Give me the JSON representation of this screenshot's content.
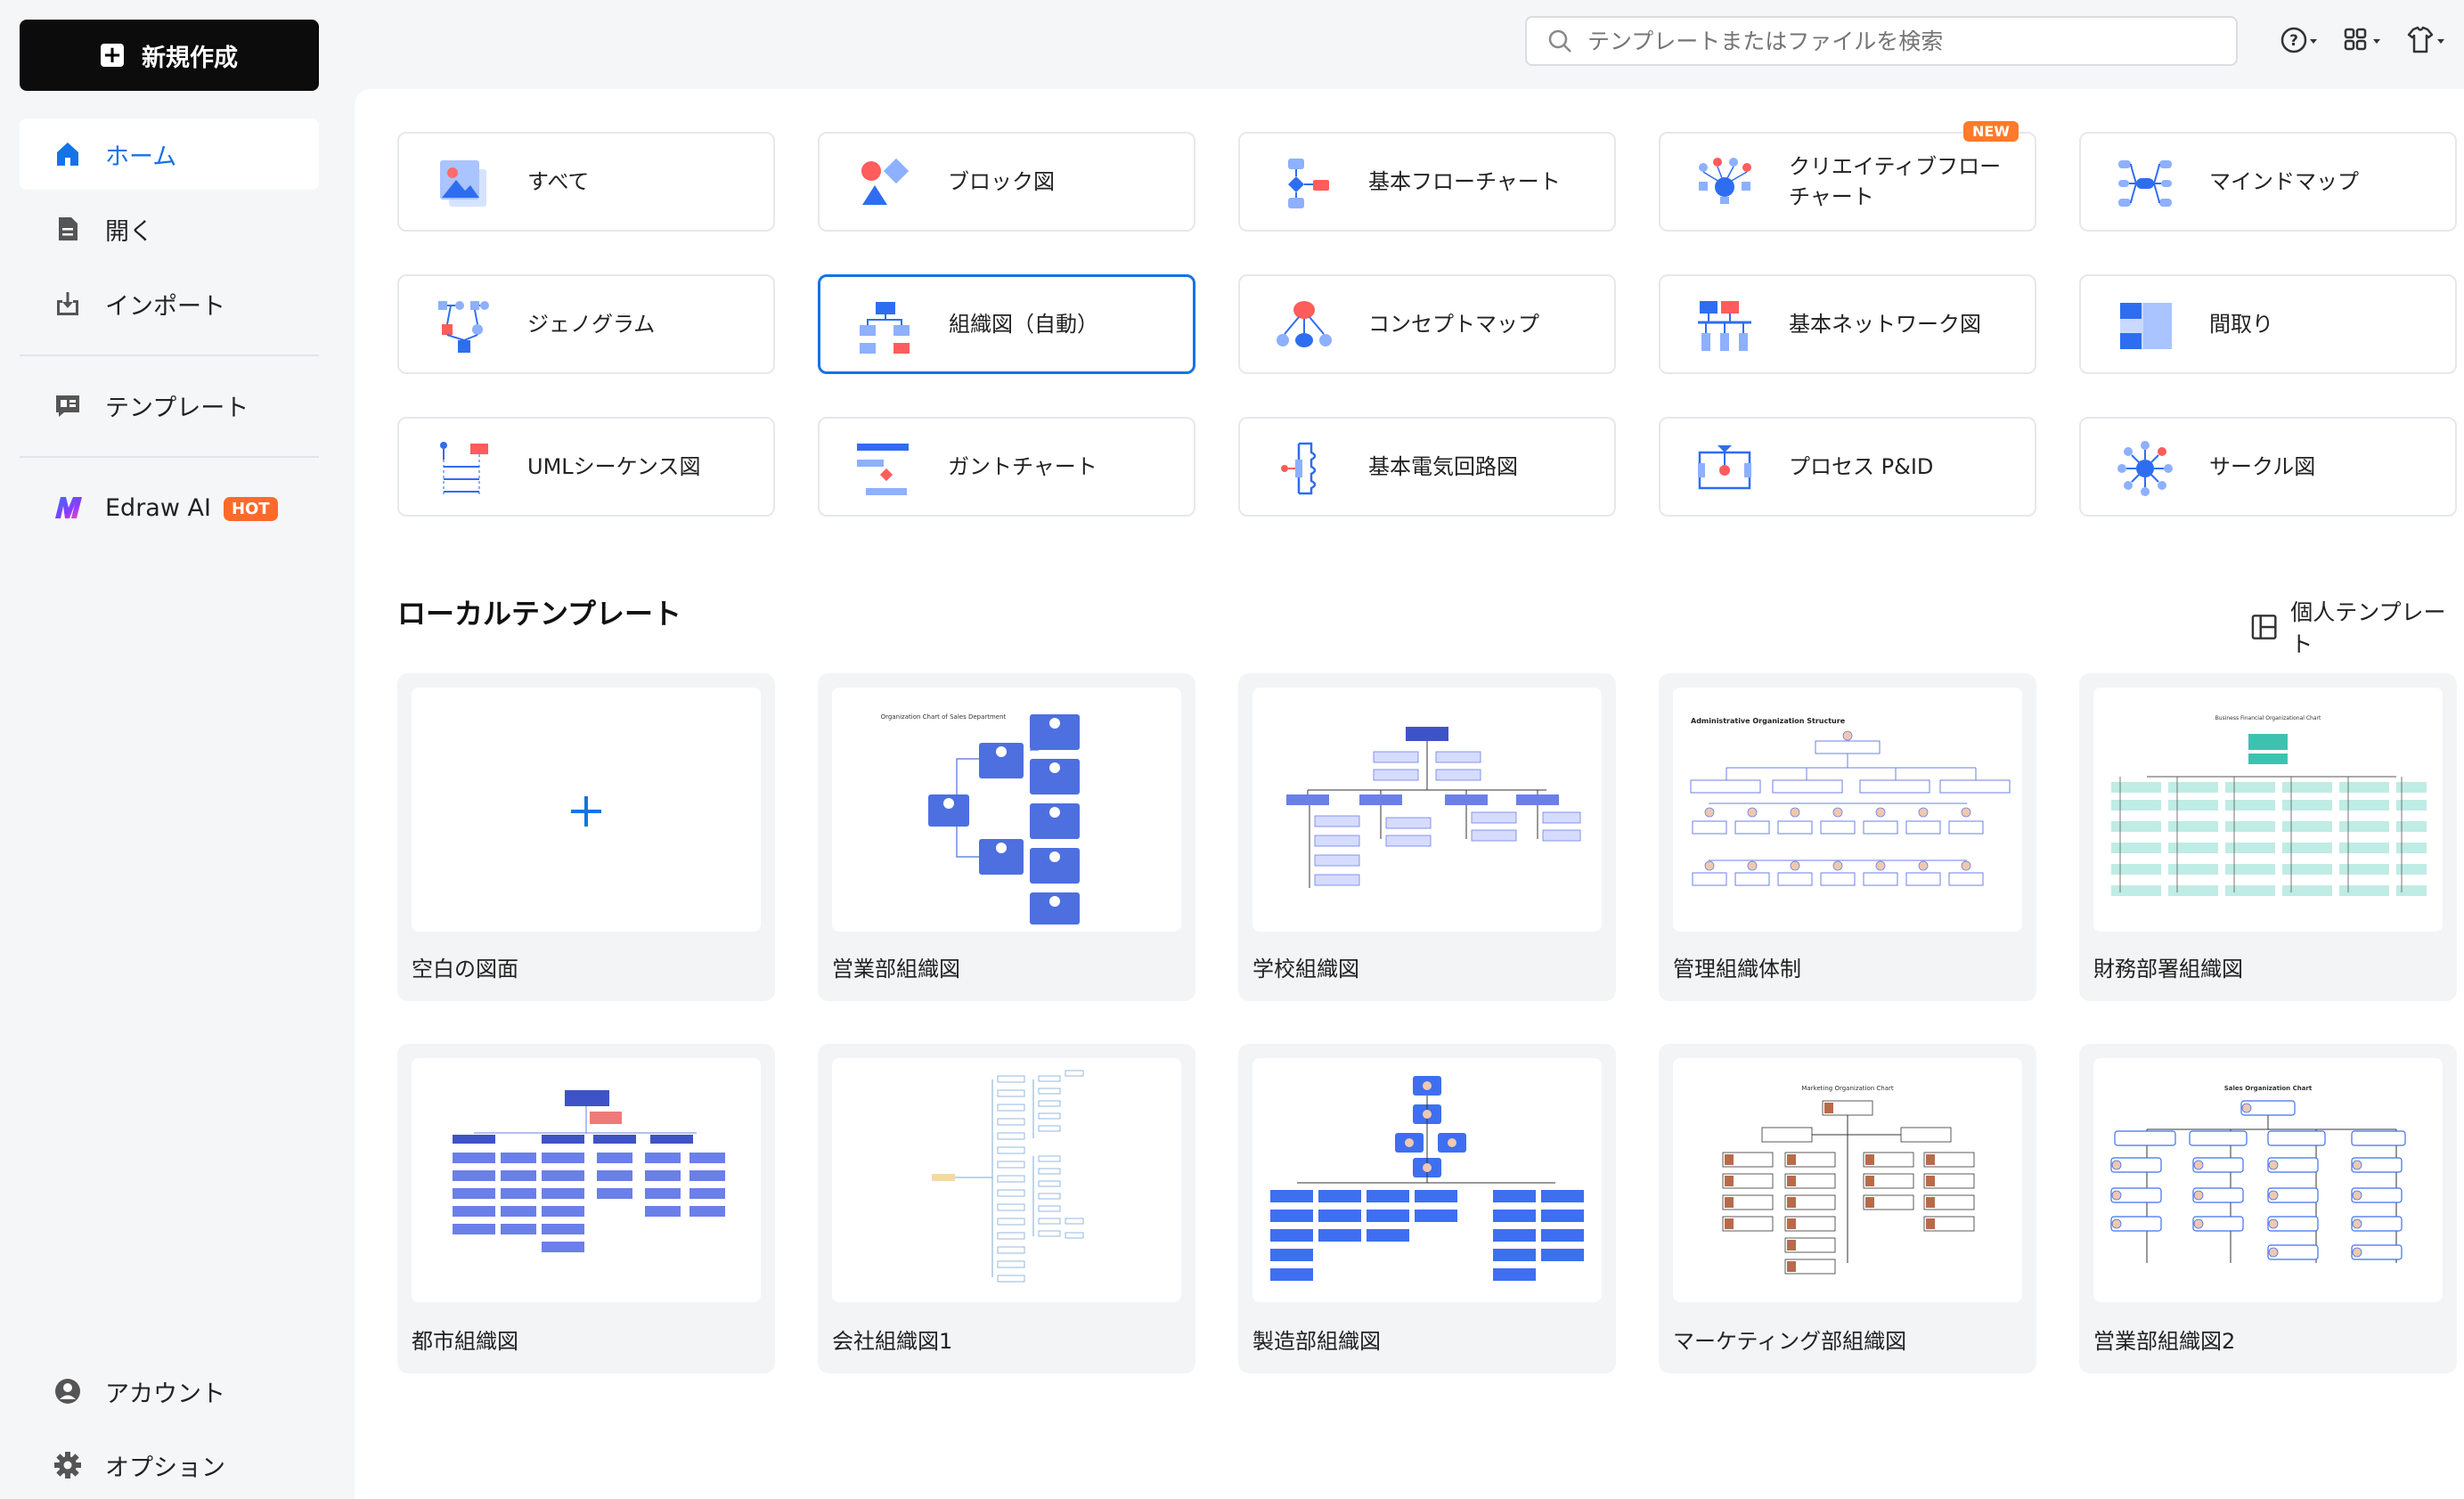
{
  "sidebar": {
    "new_button": "新規作成",
    "items": [
      {
        "label": "ホーム",
        "icon": "home-icon"
      },
      {
        "label": "開く",
        "icon": "file-icon"
      },
      {
        "label": "インポート",
        "icon": "import-icon"
      },
      {
        "label": "テンプレート",
        "icon": "template-icon"
      },
      {
        "label": "Edraw AI",
        "icon": "edraw-ai-logo-icon",
        "badge": "HOT"
      }
    ],
    "bottom": [
      {
        "label": "アカウント",
        "icon": "account-icon"
      },
      {
        "label": "オプション",
        "icon": "gear-icon"
      }
    ]
  },
  "search": {
    "placeholder": "テンプレートまたはファイルを検索"
  },
  "categories": [
    {
      "label": "すべて"
    },
    {
      "label": "ブロック図"
    },
    {
      "label": "基本フローチャート"
    },
    {
      "label": "クリエイティブフローチャート",
      "badge": "NEW"
    },
    {
      "label": "マインドマップ"
    },
    {
      "label": "ジェノグラム"
    },
    {
      "label": "組織図（自動）"
    },
    {
      "label": "コンセプトマップ"
    },
    {
      "label": "基本ネットワーク図"
    },
    {
      "label": "間取り"
    },
    {
      "label": "UMLシーケンス図"
    },
    {
      "label": "ガントチャート"
    },
    {
      "label": "基本電気回路図"
    },
    {
      "label": "プロセス P&ID"
    },
    {
      "label": "サークル図"
    }
  ],
  "local": {
    "title": "ローカルテンプレート",
    "personal": "個人テンプレート",
    "templates": [
      {
        "name": "空白の図面"
      },
      {
        "name": "営業部組織図",
        "thumb_title": "Organization Chart of Sales Department"
      },
      {
        "name": "学校組織図"
      },
      {
        "name": "管理組織体制",
        "thumb_title": "Administrative Organization Structure"
      },
      {
        "name": "財務部署組織図",
        "thumb_title": "Business Financial Organizational Chart"
      },
      {
        "name": "都市組織図"
      },
      {
        "name": "会社組織図1"
      },
      {
        "name": "製造部組織図"
      },
      {
        "name": "マーケティング部組織図",
        "thumb_title": "Marketing Organization Chart"
      },
      {
        "name": "営業部組織図2",
        "thumb_title": "Sales Organization Chart"
      }
    ]
  },
  "colors": {
    "accent": "#1473e6",
    "hot": "#ff6a2a",
    "node_blue": "#6b7fe8",
    "node_red": "#ff6b6b"
  }
}
